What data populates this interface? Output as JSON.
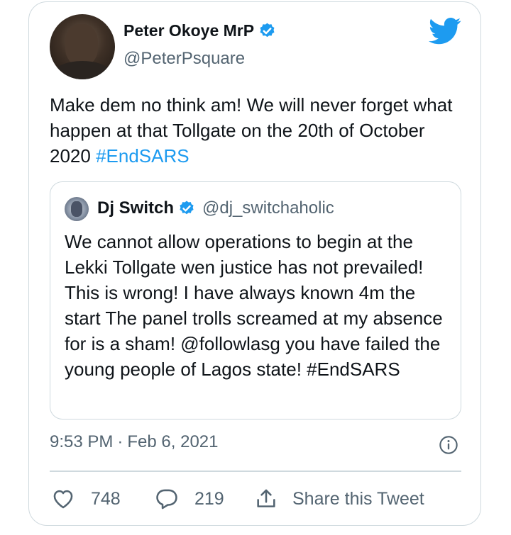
{
  "author": {
    "name": "Peter Okoye MrP",
    "handle": "@PeterPsquare"
  },
  "tweet": {
    "text": "Make dem no think am! We will never forget what happen at that Tollgate on the 20th of October 2020 ",
    "hashtag": "#EndSARS"
  },
  "quoted": {
    "name": "Dj Switch",
    "handle": "@dj_switchaholic",
    "text": "We cannot allow operations to begin at the Lekki Tollgate wen justice has not prevailed! This is wrong! I have always known 4m the start The panel trolls screamed at my absence for is a sham! @followlasg you have failed the young people of Lagos state! #EndSARS"
  },
  "meta": {
    "time": "9:53 PM",
    "separator": "·",
    "date": "Feb 6, 2021"
  },
  "actions": {
    "likes": "748",
    "replies": "219",
    "share_label": "Share this Tweet"
  },
  "colors": {
    "accent": "#1d9bf0",
    "text": "#0f1419",
    "secondary": "#536471",
    "border": "#cfd9de"
  },
  "icons": [
    "verified-badge-icon",
    "twitter-bird-icon",
    "info-icon",
    "heart-icon",
    "reply-bubble-icon",
    "share-icon"
  ]
}
